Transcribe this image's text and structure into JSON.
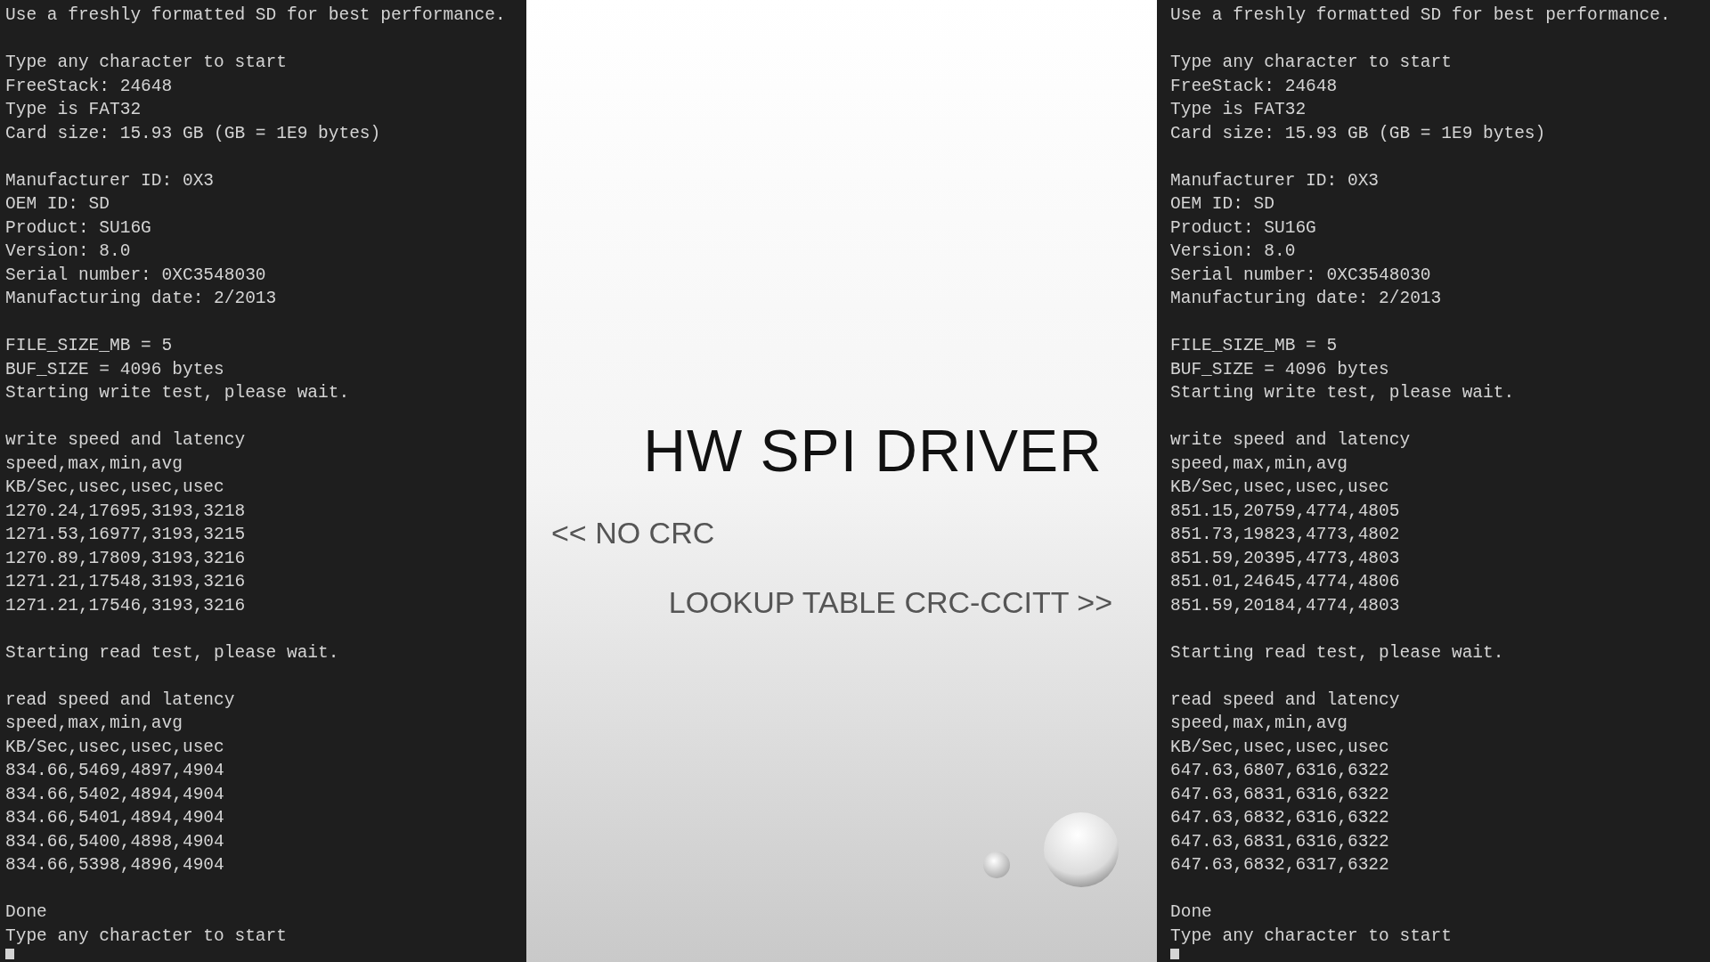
{
  "left_terminal": {
    "blocks": [
      [
        "Use a freshly formatted SD for best performance."
      ],
      [
        "Type any character to start",
        "FreeStack: 24648",
        "Type is FAT32",
        "Card size: 15.93 GB (GB = 1E9 bytes)"
      ],
      [
        "Manufacturer ID: 0X3",
        "OEM ID: SD",
        "Product: SU16G",
        "Version: 8.0",
        "Serial number: 0XC3548030",
        "Manufacturing date: 2/2013"
      ],
      [
        "FILE_SIZE_MB = 5",
        "BUF_SIZE = 4096 bytes",
        "Starting write test, please wait."
      ],
      [
        "write speed and latency",
        "speed,max,min,avg",
        "KB/Sec,usec,usec,usec",
        "1270.24,17695,3193,3218",
        "1271.53,16977,3193,3215",
        "1270.89,17809,3193,3216",
        "1271.21,17548,3193,3216",
        "1271.21,17546,3193,3216"
      ],
      [
        "Starting read test, please wait."
      ],
      [
        "read speed and latency",
        "speed,max,min,avg",
        "KB/Sec,usec,usec,usec",
        "834.66,5469,4897,4904",
        "834.66,5402,4894,4904",
        "834.66,5401,4894,4904",
        "834.66,5400,4898,4904",
        "834.66,5398,4896,4904"
      ],
      [
        "Done",
        "Type any character to start"
      ]
    ]
  },
  "slide": {
    "title": "HW SPI DRIVER",
    "left_note": "<< NO CRC",
    "right_note": "LOOKUP TABLE CRC-CCITT >>"
  },
  "right_terminal": {
    "blocks": [
      [
        "Use a freshly formatted SD for best performance."
      ],
      [
        "Type any character to start",
        "FreeStack: 24648",
        "Type is FAT32",
        "Card size: 15.93 GB (GB = 1E9 bytes)"
      ],
      [
        "Manufacturer ID: 0X3",
        "OEM ID: SD",
        "Product: SU16G",
        "Version: 8.0",
        "Serial number: 0XC3548030",
        "Manufacturing date: 2/2013"
      ],
      [
        "FILE_SIZE_MB = 5",
        "BUF_SIZE = 4096 bytes",
        "Starting write test, please wait."
      ],
      [
        "write speed and latency",
        "speed,max,min,avg",
        "KB/Sec,usec,usec,usec",
        "851.15,20759,4774,4805",
        "851.73,19823,4773,4802",
        "851.59,20395,4773,4803",
        "851.01,24645,4774,4806",
        "851.59,20184,4774,4803"
      ],
      [
        "Starting read test, please wait."
      ],
      [
        "read speed and latency",
        "speed,max,min,avg",
        "KB/Sec,usec,usec,usec",
        "647.63,6807,6316,6322",
        "647.63,6831,6316,6322",
        "647.63,6832,6316,6322",
        "647.63,6831,6316,6322",
        "647.63,6832,6317,6322"
      ],
      [
        "Done",
        "Type any character to start"
      ]
    ]
  }
}
